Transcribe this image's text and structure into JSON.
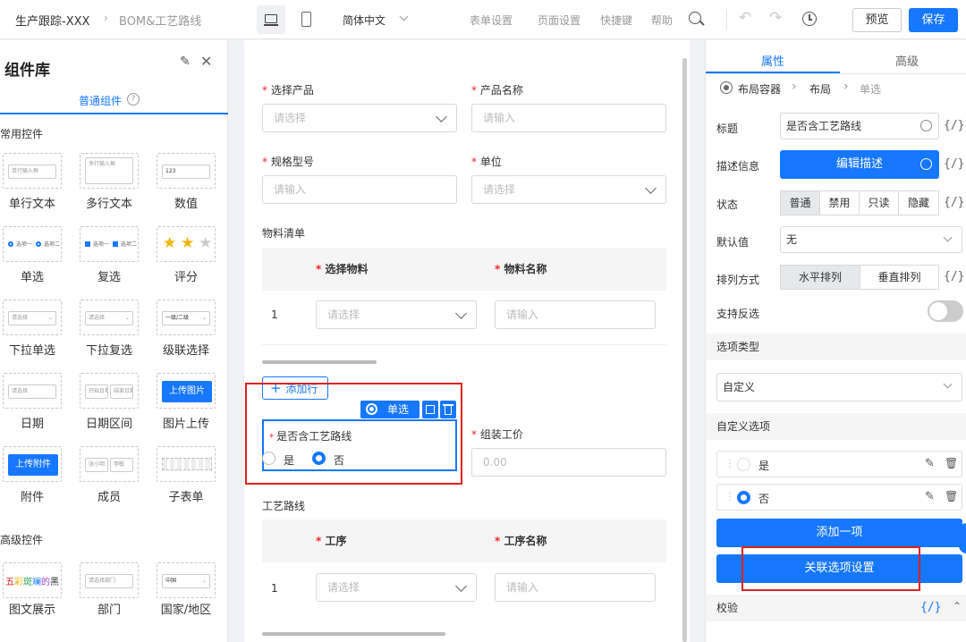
{
  "topbar": {
    "breadcrumb_1": "生产跟踪-XXX",
    "breadcrumb_2": "BOM&工艺路线",
    "language": "简体中文",
    "form_settings": "表单设置",
    "page_settings": "页面设置",
    "shortcuts": "快捷键",
    "help": "帮助",
    "preview": "预览",
    "save": "保存"
  },
  "library": {
    "title": "组件库",
    "tab": "普通组件",
    "common_section": "常用控件",
    "advanced_section": "高级控件",
    "items": [
      "单行文本",
      "多行文本",
      "数值",
      "单选",
      "复选",
      "评分",
      "下拉单选",
      "下拉复选",
      "级联选择",
      "日期",
      "日期区间",
      "图片上传",
      "附件",
      "成员",
      "子表单",
      "图文展示",
      "部门",
      "国家/地区"
    ],
    "mini": {
      "single_text": "单行输入框",
      "multi_text": "多行输入框",
      "number": "123",
      "radio_a": "选项一",
      "radio_b": "选项二",
      "check_a": "选项一",
      "check_b": "选项二",
      "select": "请选择",
      "multi_select": "请选择",
      "cascade": "一级/二级",
      "date": "请选择",
      "date_a": "开始日期",
      "date_b": "结束日期",
      "image_btn": "上传图片",
      "file_btn": "上传附件",
      "member_a": "张小明",
      "member_b": "李敏",
      "rich": "五彩斑斓的黑",
      "dept": "请选择部门",
      "country": "中国"
    }
  },
  "form": {
    "select_product": "选择产品",
    "product_name": "产品名称",
    "spec": "规格型号",
    "unit": "单位",
    "select_ph": "请选择",
    "input_ph": "请输入",
    "bom_title": "物料清单",
    "col_material": "选择物料",
    "col_material_name": "物料名称",
    "row1": "1",
    "add_row": "添加行",
    "radio_toolbar": "单选",
    "radio_label": "是否含工艺路线",
    "opt_yes": "是",
    "opt_no": "否",
    "assembly_cost": "组装工价",
    "cost_ph": "0.00",
    "route_title": "工艺路线",
    "col_process": "工序",
    "col_process_name": "工序名称",
    "row2": "1"
  },
  "props": {
    "tab_props": "属性",
    "tab_adv": "高级",
    "bc_1": "布局容器",
    "bc_2": "布局",
    "bc_3": "单选",
    "title_label": "标题",
    "title_value": "是否含工艺路线",
    "desc_label": "描述信息",
    "desc_btn": "编辑描述",
    "status_label": "状态",
    "status_opts": [
      "普通",
      "禁用",
      "只读",
      "隐藏"
    ],
    "default_label": "默认值",
    "default_value": "无",
    "layout_label": "排列方式",
    "layout_opts": [
      "水平排列",
      "垂直排列"
    ],
    "invert_label": "支持反选",
    "option_type_section": "选项类型",
    "option_type_value": "自定义",
    "custom_section": "自定义选项",
    "opt1": "是",
    "opt2": "否",
    "add_item": "添加一项",
    "assoc": "关联选项设置",
    "validate": "校验",
    "fx": "{/}"
  },
  "colors": {
    "accent": "#1677ff",
    "highlight": "#e02020"
  }
}
